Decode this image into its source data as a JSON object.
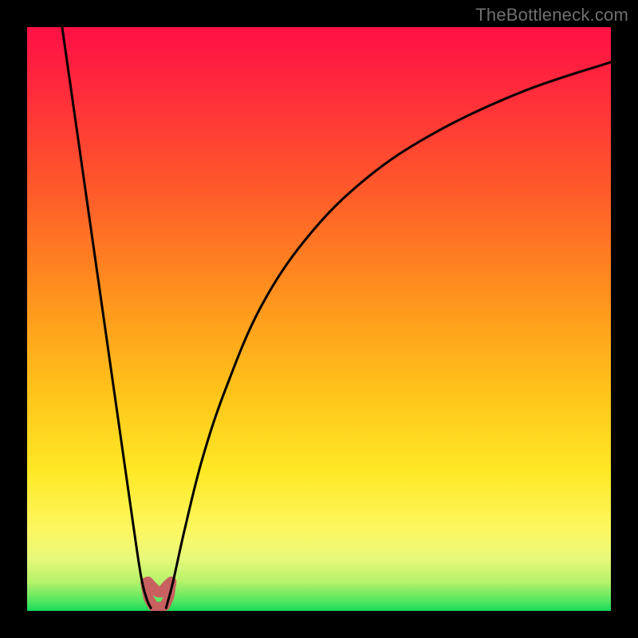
{
  "watermark": "TheBottleneck.com",
  "colors": {
    "border": "#000000",
    "curve": "#000000",
    "blob": "#c96060",
    "gradient_stops": [
      {
        "offset": 0.0,
        "color": "#ff1045"
      },
      {
        "offset": 0.12,
        "color": "#ff2e3a"
      },
      {
        "offset": 0.28,
        "color": "#ff5a2a"
      },
      {
        "offset": 0.45,
        "color": "#ff8f1e"
      },
      {
        "offset": 0.62,
        "color": "#ffc21a"
      },
      {
        "offset": 0.76,
        "color": "#ffe825"
      },
      {
        "offset": 0.86,
        "color": "#fdf760"
      },
      {
        "offset": 0.91,
        "color": "#e8f87a"
      },
      {
        "offset": 0.95,
        "color": "#b6f26a"
      },
      {
        "offset": 0.985,
        "color": "#4ee65f"
      },
      {
        "offset": 1.0,
        "color": "#18da5a"
      }
    ]
  },
  "chart_data": {
    "type": "line",
    "title": "",
    "xlabel": "",
    "ylabel": "",
    "xlim": [
      0,
      100
    ],
    "ylim": [
      0,
      100
    ],
    "series": [
      {
        "name": "left-branch",
        "x": [
          6,
          8,
          10,
          12,
          14,
          16,
          18,
          19.5,
          20.5,
          21.2
        ],
        "y": [
          100,
          86,
          72,
          58,
          44,
          30,
          16,
          6,
          2,
          0.5
        ]
      },
      {
        "name": "right-branch",
        "x": [
          23.8,
          25,
          27,
          30,
          34,
          40,
          48,
          58,
          70,
          85,
          100
        ],
        "y": [
          0.5,
          5,
          14,
          26,
          38,
          52,
          64,
          74,
          82,
          89,
          94
        ]
      }
    ],
    "blob": {
      "name": "selected-region",
      "points": [
        {
          "x": 20.3,
          "y": 4.8
        },
        {
          "x": 20.8,
          "y": 2.2
        },
        {
          "x": 21.6,
          "y": 0.8
        },
        {
          "x": 22.6,
          "y": 0.6
        },
        {
          "x": 23.6,
          "y": 0.9
        },
        {
          "x": 24.3,
          "y": 2.4
        },
        {
          "x": 24.7,
          "y": 5.0
        },
        {
          "x": 24.0,
          "y": 4.4
        },
        {
          "x": 23.0,
          "y": 3.2
        },
        {
          "x": 22.4,
          "y": 3.2
        },
        {
          "x": 21.4,
          "y": 4.2
        },
        {
          "x": 20.7,
          "y": 5.0
        }
      ]
    }
  }
}
